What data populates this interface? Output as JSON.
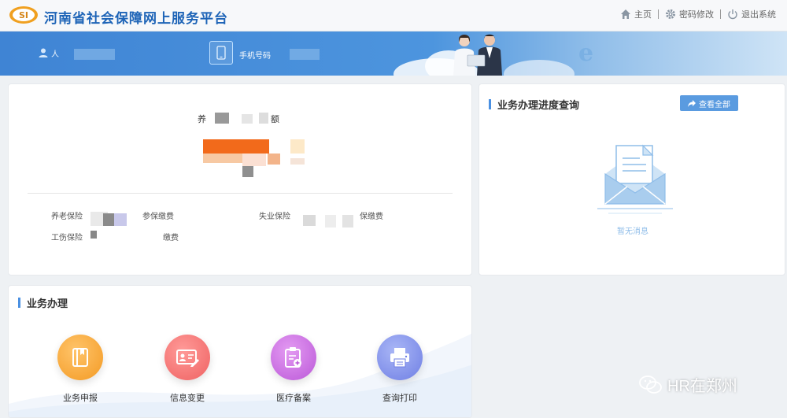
{
  "header": {
    "site_title": "河南省社会保障网上服务平台",
    "logo_text": "SI",
    "nav": [
      {
        "label": "主页",
        "icon": "home-icon"
      },
      {
        "label": "密码修改",
        "icon": "gear-icon"
      },
      {
        "label": "退出系统",
        "icon": "power-icon"
      }
    ]
  },
  "banner": {
    "user_label": "人",
    "phone_label": "手机号码"
  },
  "account": {
    "caption_left": "养",
    "caption_right": "额",
    "insurance_labels": [
      "养老保险",
      "参保缴费",
      "失业保险",
      "保缴费",
      "工伤保险",
      "缴费"
    ]
  },
  "progress": {
    "title": "业务办理进度查询",
    "view_all_label": "查看全部",
    "empty_text": "暂无消息"
  },
  "business": {
    "title": "业务办理",
    "services": [
      {
        "label": "业务申报",
        "icon": "book-icon",
        "color": "#f5a53a"
      },
      {
        "label": "信息变更",
        "icon": "id-card-icon",
        "color": "#f47576"
      },
      {
        "label": "医疗备案",
        "icon": "clipboard-medical-icon",
        "color": "#c96be0"
      },
      {
        "label": "查询打印",
        "icon": "printer-icon",
        "color": "#7f8fe8"
      }
    ]
  },
  "watermark": {
    "text": "HR在郑州"
  }
}
